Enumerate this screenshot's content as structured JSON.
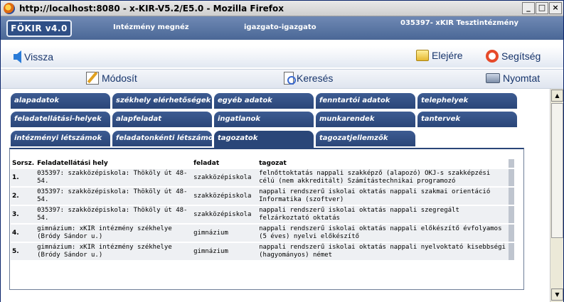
{
  "window": {
    "title": "http://localhost:8080 - x-KIR-V5.2/E5.0 - Mozilla Firefox",
    "controls": {
      "minimize": "_",
      "maximize": "□",
      "close": "×"
    }
  },
  "header": {
    "logo": "FÖKIR v4.0",
    "institution_label": "Intézmény megnéz",
    "user": "igazgato-igazgato",
    "institution_code": "035397- xKIR Tesztintézmény"
  },
  "nav": {
    "back": "Vissza",
    "home": "Elejére",
    "help": "Segítség"
  },
  "toolbar": {
    "edit": "Módosít",
    "search": "Keresés",
    "print": "Nyomtat"
  },
  "tabs": [
    {
      "label": "alapadatok"
    },
    {
      "label": "székhely elérhetőségek"
    },
    {
      "label": "egyéb adatok"
    },
    {
      "label": "fenntartói adatok"
    },
    {
      "label": "telephelyek"
    },
    {
      "label": "feladatellátási-helyek"
    },
    {
      "label": "alapfeladat"
    },
    {
      "label": "ingatlanok"
    },
    {
      "label": "munkarendek"
    },
    {
      "label": "tantervek"
    },
    {
      "label": "intézményi létszámok"
    },
    {
      "label": "feladatonkénti létszámok"
    },
    {
      "label": "tagozatok"
    },
    {
      "label": "tagozatjellemzők"
    }
  ],
  "active_tab": "tagozatok",
  "table": {
    "headers": [
      "Sorsz.",
      "Feladatellátási hely",
      "feladat",
      "tagozat"
    ],
    "rows": [
      {
        "n": "1.",
        "hely": "035397: szakközépiskola: Thököly út 48-54.",
        "feladat": "szakközépiskola",
        "tagozat": "felnőttoktatás nappali szakképző (alapozó) OKJ-s szakképzési célú (nem akkreditált) Számítástechnikai programozó"
      },
      {
        "n": "2.",
        "hely": "035397: szakközépiskola: Thököly út 48-54.",
        "feladat": "szakközépiskola",
        "tagozat": "nappali rendszerű iskolai oktatás nappali szakmai orientáció Informatika (szoftver)"
      },
      {
        "n": "3.",
        "hely": "035397: szakközépiskola: Thököly út 48-54.",
        "feladat": "szakközépiskola",
        "tagozat": "nappali rendszerű iskolai oktatás nappali szegregált felzárkoztató oktatás"
      },
      {
        "n": "4.",
        "hely": "gimnázium: xKIR intézmény székhelye (Bródy Sándor u.)",
        "feladat": "gimnázium",
        "tagozat": "nappali rendszerű iskolai oktatás nappali előkészítő évfolyamos (5 éves) nyelvi előkészítő"
      },
      {
        "n": "5.",
        "hely": "gimnázium: xKIR intézmény székhelye (Bródy Sándor u.)",
        "feladat": "gimnázium",
        "tagozat": "nappali rendszerű iskolai oktatás nappali nyelvoktató kisebbségi (hagyományos) német"
      }
    ]
  }
}
